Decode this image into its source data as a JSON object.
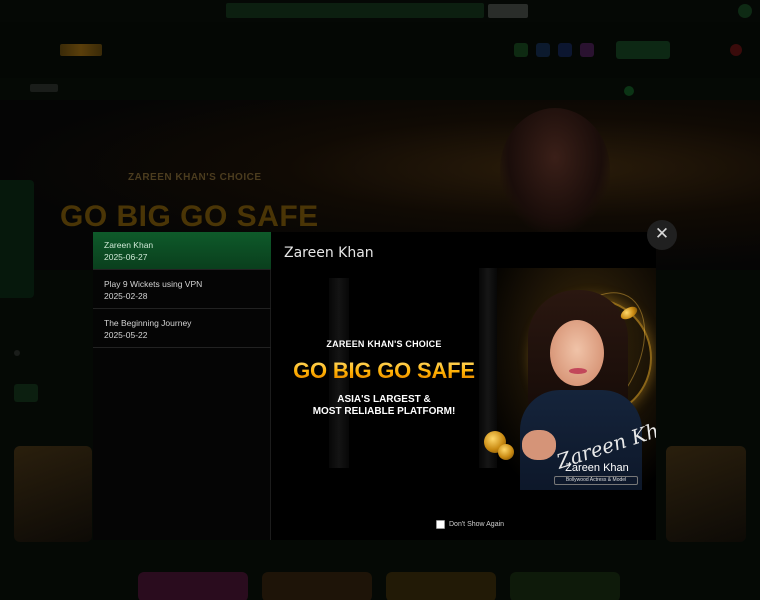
{
  "modal": {
    "title": "Zareen Khan",
    "close_icon": "✕",
    "sidebar": {
      "items": [
        {
          "title": "Zareen Khan",
          "date": "2025-06-27",
          "active": true
        },
        {
          "title": "Play 9 Wickets using VPN",
          "date": "2025-02-28",
          "active": false
        },
        {
          "title": "The Beginning Journey",
          "date": "2025-05-22",
          "active": false
        }
      ]
    },
    "promo": {
      "subheading": "ZAREEN KHAN'S CHOICE",
      "headline": "GO BIG GO SAFE",
      "tagline_line1": "ASIA'S LARGEST &",
      "tagline_line2": "MOST RELIABLE PLATFORM!",
      "signature": "Zareen Khan",
      "name": "Zareen Khan",
      "role": "Bollywood Actress & Model"
    },
    "dont_show_label": "Don't Show Again"
  },
  "background": {
    "banner_subheading": "ZAREEN KHAN'S CHOICE",
    "banner_headline": "GO BIG GO SAFE"
  },
  "colors": {
    "active_item": "#0e5a2a",
    "headline_gold": "#ffae00",
    "overlay": "#000000"
  },
  "icons": [
    "close-icon",
    "checkbox-icon"
  ]
}
